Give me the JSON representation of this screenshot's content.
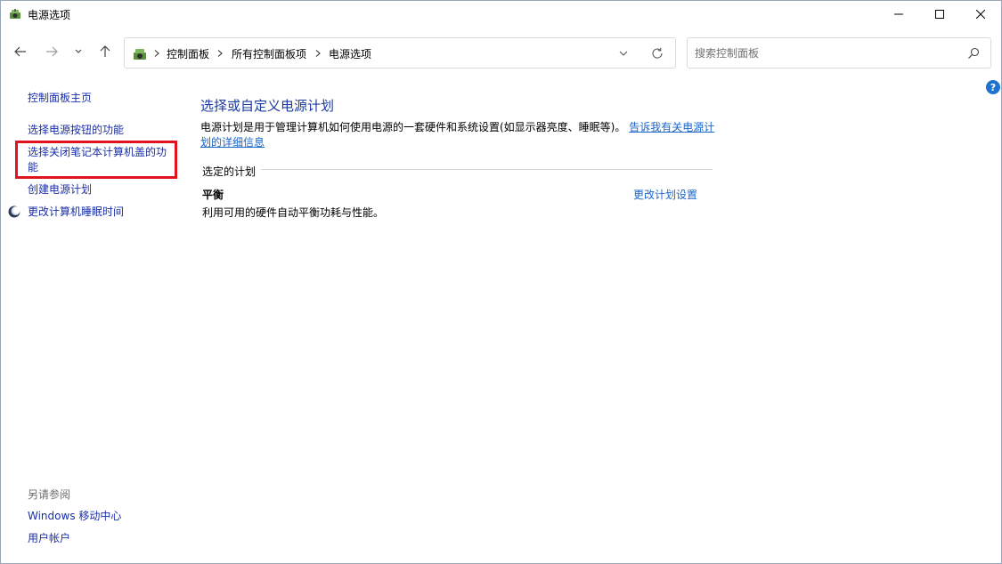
{
  "window": {
    "title": "电源选项"
  },
  "navigation": {
    "breadcrumb": [
      "控制面板",
      "所有控制面板项",
      "电源选项"
    ],
    "search_placeholder": "搜索控制面板"
  },
  "left_pane": {
    "links": [
      "控制面板主页",
      "选择电源按钮的功能",
      "选择关闭笔记本计算机盖的功能",
      "创建电源计划",
      "更改计算机睡眠时间"
    ],
    "see_also_label": "另请参阅",
    "see_also_links": [
      "Windows 移动中心",
      "用户帐户"
    ]
  },
  "main": {
    "title": "选择或自定义电源计划",
    "description": "电源计划是用于管理计算机如何使用电源的一套硬件和系统设置(如显示器亮度、睡眠等)。",
    "description_link_part1": "告诉我有关电源计",
    "description_link_part2": "划的详细信息",
    "selected_plan_label": "选定的计划",
    "plan": {
      "name": "平衡",
      "description": "利用可用的硬件自动平衡功耗与性能。",
      "change_link": "更改计划设置"
    }
  },
  "colors": {
    "link": "#1a2ea8",
    "title": "#1c3aa0",
    "highlight_border": "#e0141e",
    "help": "#1e73cf"
  },
  "icons": {
    "app": "power-options-icon",
    "help": "help-icon",
    "moon": "moon-icon"
  }
}
